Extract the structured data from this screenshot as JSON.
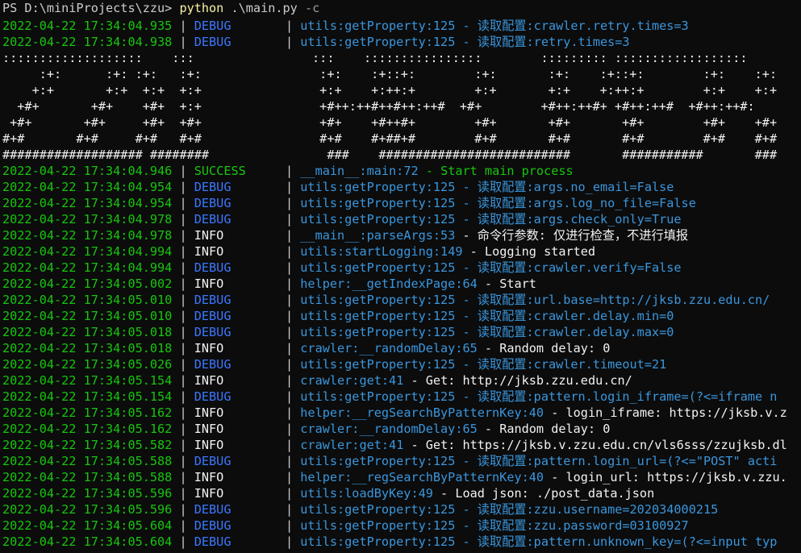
{
  "window": {
    "background": "#0c0c0c"
  },
  "colors": {
    "timestamp": "#16c60c",
    "debug": "#3b78ff",
    "info": "#f2f2f2",
    "success": "#16c60c",
    "debug_message": "#3a96dd",
    "info_location": "#3a96dd",
    "python_keyword": "#f9f1a5",
    "flag": "#9a9a9a"
  },
  "prompt": {
    "path": "PS D:\\miniProjects\\zzu>",
    "command": "python",
    "script": ".\\main.py",
    "flag": "-c"
  },
  "lines": [
    {
      "kind": "log",
      "ts": "2022-04-22 17:34:04.935",
      "level": "DEBUG",
      "module": "utils",
      "func": "getProperty",
      "lineno": "125",
      "msg": "读取配置:crawler.retry.times=3"
    },
    {
      "kind": "log",
      "ts": "2022-04-22 17:34:04.938",
      "level": "DEBUG",
      "module": "utils",
      "func": "getProperty",
      "lineno": "125",
      "msg": "读取配置:retry.times=3"
    },
    {
      "kind": "art",
      "text": ":::::::::::::::::::    :::                :::    ::::::::::::::::        ::::::::: ::::::::::::::::::"
    },
    {
      "kind": "art",
      "text": "     :+:      :+: :+:   :+:                :+:    :+::+:        :+:       :+:    :+::+:        :+:    :+:"
    },
    {
      "kind": "art",
      "text": "    +:+       +:+  +:+  +:+                +:+    +:++:+        +:+       +:+    +:++:+        +:+    +:+"
    },
    {
      "kind": "art",
      "text": "  +#+       +#+    +#+  +:+                +#++:++#++#++:++#  +#+        +#++:++#+ +#++:++#  +#++:++#:"
    },
    {
      "kind": "art",
      "text": " +#+       +#+     +#+  +#+                +#+    +#++#+        +#+       +#+       +#+        +#+    +#+"
    },
    {
      "kind": "art",
      "text": "#+#       #+#     #+#   #+#                #+#    #+##+#        #+#       #+#       #+#        #+#    #+#"
    },
    {
      "kind": "art",
      "text": "################### ########                ###    ##########################       ###########       ###"
    },
    {
      "kind": "log",
      "ts": "2022-04-22 17:34:04.946",
      "level": "SUCCESS",
      "module": "__main__",
      "func": "main",
      "lineno": "72",
      "msg": "Start main process"
    },
    {
      "kind": "log",
      "ts": "2022-04-22 17:34:04.954",
      "level": "DEBUG",
      "module": "utils",
      "func": "getProperty",
      "lineno": "125",
      "msg": "读取配置:args.no_email=False"
    },
    {
      "kind": "log",
      "ts": "2022-04-22 17:34:04.954",
      "level": "DEBUG",
      "module": "utils",
      "func": "getProperty",
      "lineno": "125",
      "msg": "读取配置:args.log_no_file=False"
    },
    {
      "kind": "log",
      "ts": "2022-04-22 17:34:04.978",
      "level": "DEBUG",
      "module": "utils",
      "func": "getProperty",
      "lineno": "125",
      "msg": "读取配置:args.check_only=True"
    },
    {
      "kind": "log",
      "ts": "2022-04-22 17:34:04.978",
      "level": "INFO",
      "module": "__main__",
      "func": "parseArgs",
      "lineno": "53",
      "msg": "命令行参数: 仅进行检查，不进行填报"
    },
    {
      "kind": "log",
      "ts": "2022-04-22 17:34:04.994",
      "level": "INFO",
      "module": "utils",
      "func": "startLogging",
      "lineno": "149",
      "msg": "Logging started"
    },
    {
      "kind": "log",
      "ts": "2022-04-22 17:34:04.994",
      "level": "DEBUG",
      "module": "utils",
      "func": "getProperty",
      "lineno": "125",
      "msg": "读取配置:crawler.verify=False"
    },
    {
      "kind": "log",
      "ts": "2022-04-22 17:34:05.002",
      "level": "INFO",
      "module": "helper",
      "func": "__getIndexPage",
      "lineno": "64",
      "msg": "Start"
    },
    {
      "kind": "log",
      "ts": "2022-04-22 17:34:05.010",
      "level": "DEBUG",
      "module": "utils",
      "func": "getProperty",
      "lineno": "125",
      "msg": "读取配置:url.base=http://jksb.zzu.edu.cn/"
    },
    {
      "kind": "log",
      "ts": "2022-04-22 17:34:05.010",
      "level": "DEBUG",
      "module": "utils",
      "func": "getProperty",
      "lineno": "125",
      "msg": "读取配置:crawler.delay.min=0"
    },
    {
      "kind": "log",
      "ts": "2022-04-22 17:34:05.018",
      "level": "DEBUG",
      "module": "utils",
      "func": "getProperty",
      "lineno": "125",
      "msg": "读取配置:crawler.delay.max=0"
    },
    {
      "kind": "log",
      "ts": "2022-04-22 17:34:05.018",
      "level": "INFO",
      "module": "crawler",
      "func": "__randomDelay",
      "lineno": "65",
      "msg": "Random delay: 0"
    },
    {
      "kind": "log",
      "ts": "2022-04-22 17:34:05.026",
      "level": "DEBUG",
      "module": "utils",
      "func": "getProperty",
      "lineno": "125",
      "msg": "读取配置:crawler.timeout=21"
    },
    {
      "kind": "log",
      "ts": "2022-04-22 17:34:05.154",
      "level": "INFO",
      "module": "crawler",
      "func": "get",
      "lineno": "41",
      "msg": "Get: http://jksb.zzu.edu.cn/"
    },
    {
      "kind": "log",
      "ts": "2022-04-22 17:34:05.154",
      "level": "DEBUG",
      "module": "utils",
      "func": "getProperty",
      "lineno": "125",
      "msg": "读取配置:pattern.login_iframe=(?<=iframe n"
    },
    {
      "kind": "log",
      "ts": "2022-04-22 17:34:05.162",
      "level": "INFO",
      "module": "helper",
      "func": "__regSearchByPatternKey",
      "lineno": "40",
      "msg": "login_iframe: https://jksb.v.z"
    },
    {
      "kind": "log",
      "ts": "2022-04-22 17:34:05.162",
      "level": "INFO",
      "module": "crawler",
      "func": "__randomDelay",
      "lineno": "65",
      "msg": "Random delay: 0"
    },
    {
      "kind": "log",
      "ts": "2022-04-22 17:34:05.582",
      "level": "INFO",
      "module": "crawler",
      "func": "get",
      "lineno": "41",
      "msg": "Get: https://jksb.v.zzu.edu.cn/vls6sss/zzujksb.dl"
    },
    {
      "kind": "log",
      "ts": "2022-04-22 17:34:05.588",
      "level": "DEBUG",
      "module": "utils",
      "func": "getProperty",
      "lineno": "125",
      "msg": "读取配置:pattern.login_url=(?<=\"POST\" acti"
    },
    {
      "kind": "log",
      "ts": "2022-04-22 17:34:05.588",
      "level": "INFO",
      "module": "helper",
      "func": "__regSearchByPatternKey",
      "lineno": "40",
      "msg": "login_url: https://jksb.v.zzu."
    },
    {
      "kind": "log",
      "ts": "2022-04-22 17:34:05.596",
      "level": "INFO",
      "module": "utils",
      "func": "loadByKey",
      "lineno": "49",
      "msg": "Load json: ./post_data.json"
    },
    {
      "kind": "log",
      "ts": "2022-04-22 17:34:05.596",
      "level": "DEBUG",
      "module": "utils",
      "func": "getProperty",
      "lineno": "125",
      "msg": "读取配置:zzu.username=202034000215"
    },
    {
      "kind": "log",
      "ts": "2022-04-22 17:34:05.604",
      "level": "DEBUG",
      "module": "utils",
      "func": "getProperty",
      "lineno": "125",
      "msg": "读取配置:zzu.password=03100927"
    },
    {
      "kind": "log",
      "ts": "2022-04-22 17:34:05.604",
      "level": "DEBUG",
      "module": "utils",
      "func": "getProperty",
      "lineno": "125",
      "msg": "读取配置:pattern.unknown_key=(?<=input typ"
    }
  ]
}
